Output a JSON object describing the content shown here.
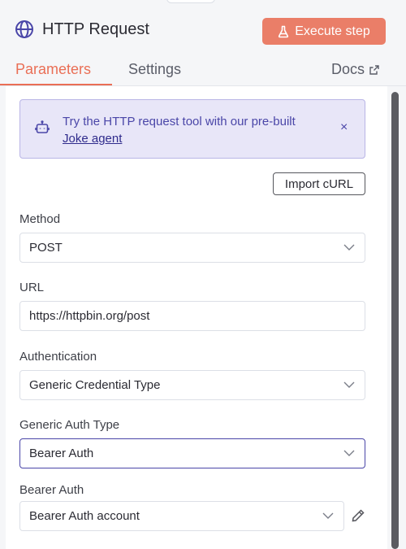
{
  "header": {
    "title": "HTTP Request",
    "icon": "globe-icon",
    "execute_label": "Execute step"
  },
  "tabs": {
    "parameters": "Parameters",
    "settings": "Settings",
    "docs": "Docs",
    "active": "Parameters"
  },
  "banner": {
    "text": "Try the HTTP request tool with our pre-built",
    "link": "Joke agent",
    "close": "×"
  },
  "import_label": "Import cURL",
  "fields": {
    "method": {
      "label": "Method",
      "value": "POST"
    },
    "url": {
      "label": "URL",
      "value": "https://httpbin.org/post"
    },
    "authentication": {
      "label": "Authentication",
      "value": "Generic Credential Type"
    },
    "generic_auth_type": {
      "label": "Generic Auth Type",
      "value": "Bearer Auth"
    },
    "bearer_auth": {
      "label": "Bearer Auth",
      "value": "Bearer Auth account"
    }
  },
  "colors": {
    "accent": "#ea7e68",
    "active_tab": "#ea6f56",
    "banner_bg": "#e8e6f8",
    "banner_text": "#4a46a8",
    "focus_border": "#4a46a8"
  }
}
